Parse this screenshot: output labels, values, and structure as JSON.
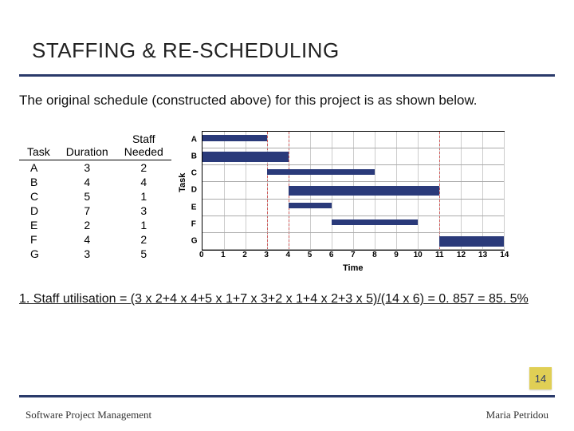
{
  "title": "STAFFING & RE-SCHEDULING",
  "subtitle": "The original schedule (constructed above) for this project is as shown below.",
  "table": {
    "headers": [
      "Task",
      "Duration",
      "Staff Needed"
    ],
    "rows": [
      {
        "task": "A",
        "duration": "3",
        "staff": "2"
      },
      {
        "task": "B",
        "duration": "4",
        "staff": "4"
      },
      {
        "task": "C",
        "duration": "5",
        "staff": "1"
      },
      {
        "task": "D",
        "duration": "7",
        "staff": "3"
      },
      {
        "task": "E",
        "duration": "2",
        "staff": "1"
      },
      {
        "task": "F",
        "duration": "4",
        "staff": "2"
      },
      {
        "task": "G",
        "duration": "3",
        "staff": "5"
      }
    ]
  },
  "chart_data": {
    "type": "bar",
    "orientation": "horizontal-gantt",
    "xlabel": "Time",
    "ylabel": "Task",
    "xlim": [
      0,
      14
    ],
    "x_ticks": [
      0,
      1,
      2,
      3,
      4,
      5,
      6,
      7,
      8,
      9,
      10,
      11,
      12,
      13,
      14
    ],
    "y_categories": [
      "A",
      "B",
      "C",
      "D",
      "E",
      "F",
      "G"
    ],
    "bars": [
      {
        "task": "A",
        "start": 0,
        "end": 3,
        "style": "narrow"
      },
      {
        "task": "B",
        "start": 0,
        "end": 4
      },
      {
        "task": "C",
        "start": 3,
        "end": 8,
        "style": "narrow"
      },
      {
        "task": "D",
        "start": 4,
        "end": 11
      },
      {
        "task": "E",
        "start": 4,
        "end": 6,
        "style": "narrow"
      },
      {
        "task": "F",
        "start": 6,
        "end": 10,
        "style": "narrow"
      },
      {
        "task": "G",
        "start": 11,
        "end": 14
      }
    ],
    "reference_lines": [
      3,
      4,
      11
    ]
  },
  "utilisation": "1. Staff utilisation = (3 x 2+4 x 4+5 x 1+7 x 3+2 x 1+4 x 2+3 x 5)/(14 x 6) = 0. 857 = 85. 5%",
  "page_number": "14",
  "footer": {
    "left": "Software Project Management",
    "right": "Maria Petridou"
  }
}
